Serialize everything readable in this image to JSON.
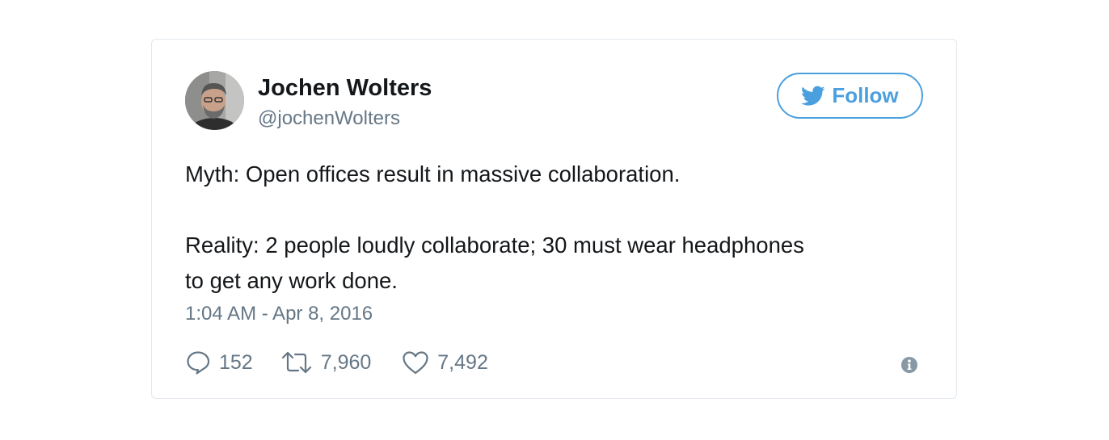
{
  "tweet": {
    "author": {
      "name": "Jochen Wolters",
      "handle": "@jochenWolters"
    },
    "follow_label": "Follow",
    "text_paragraphs": [
      "Myth: Open offices result in massive collaboration.",
      "Reality: 2 people loudly collaborate; 30 must wear headphones",
      "to get any work done."
    ],
    "timestamp": "1:04 AM - Apr 8, 2016",
    "stats": {
      "replies": "152",
      "retweets": "7,960",
      "likes": "7,492"
    },
    "icons": {
      "follow": "twitter-bird-icon",
      "reply": "reply-bubble-icon",
      "retweet": "retweet-icon",
      "like": "heart-icon",
      "info": "info-icon"
    },
    "colors": {
      "accent": "#4a9fde",
      "text": "#14171a",
      "secondary": "#657786",
      "border": "#e1e8ed"
    }
  }
}
